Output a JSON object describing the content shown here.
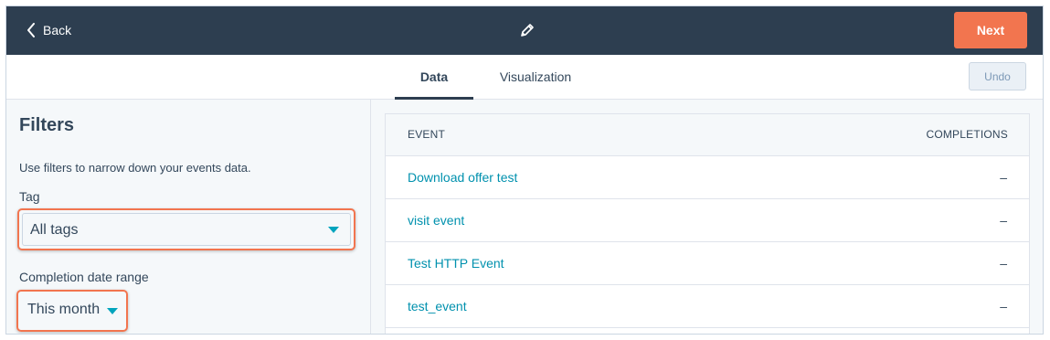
{
  "topbar": {
    "back_label": "Back",
    "edit_icon": "pencil-icon",
    "next_label": "Next"
  },
  "tabs": [
    {
      "label": "Data",
      "active": true
    },
    {
      "label": "Visualization",
      "active": false
    }
  ],
  "undo_label": "Undo",
  "filters": {
    "title": "Filters",
    "description": "Use filters to narrow down your events data.",
    "tag_label": "Tag",
    "tag_value": "All tags",
    "range_label": "Completion date range",
    "range_value": "This month"
  },
  "table": {
    "headers": {
      "event": "EVENT",
      "completions": "COMPLETIONS"
    },
    "rows": [
      {
        "event": "Download offer test",
        "completions": "–"
      },
      {
        "event": "visit event",
        "completions": "–"
      },
      {
        "event": "Test HTTP Event",
        "completions": "–"
      },
      {
        "event": "test_event",
        "completions": "–"
      }
    ]
  },
  "colors": {
    "topbar": "#2d3e50",
    "primary_button": "#f2754f",
    "link": "#0091ae",
    "highlight": "#f2754f"
  }
}
